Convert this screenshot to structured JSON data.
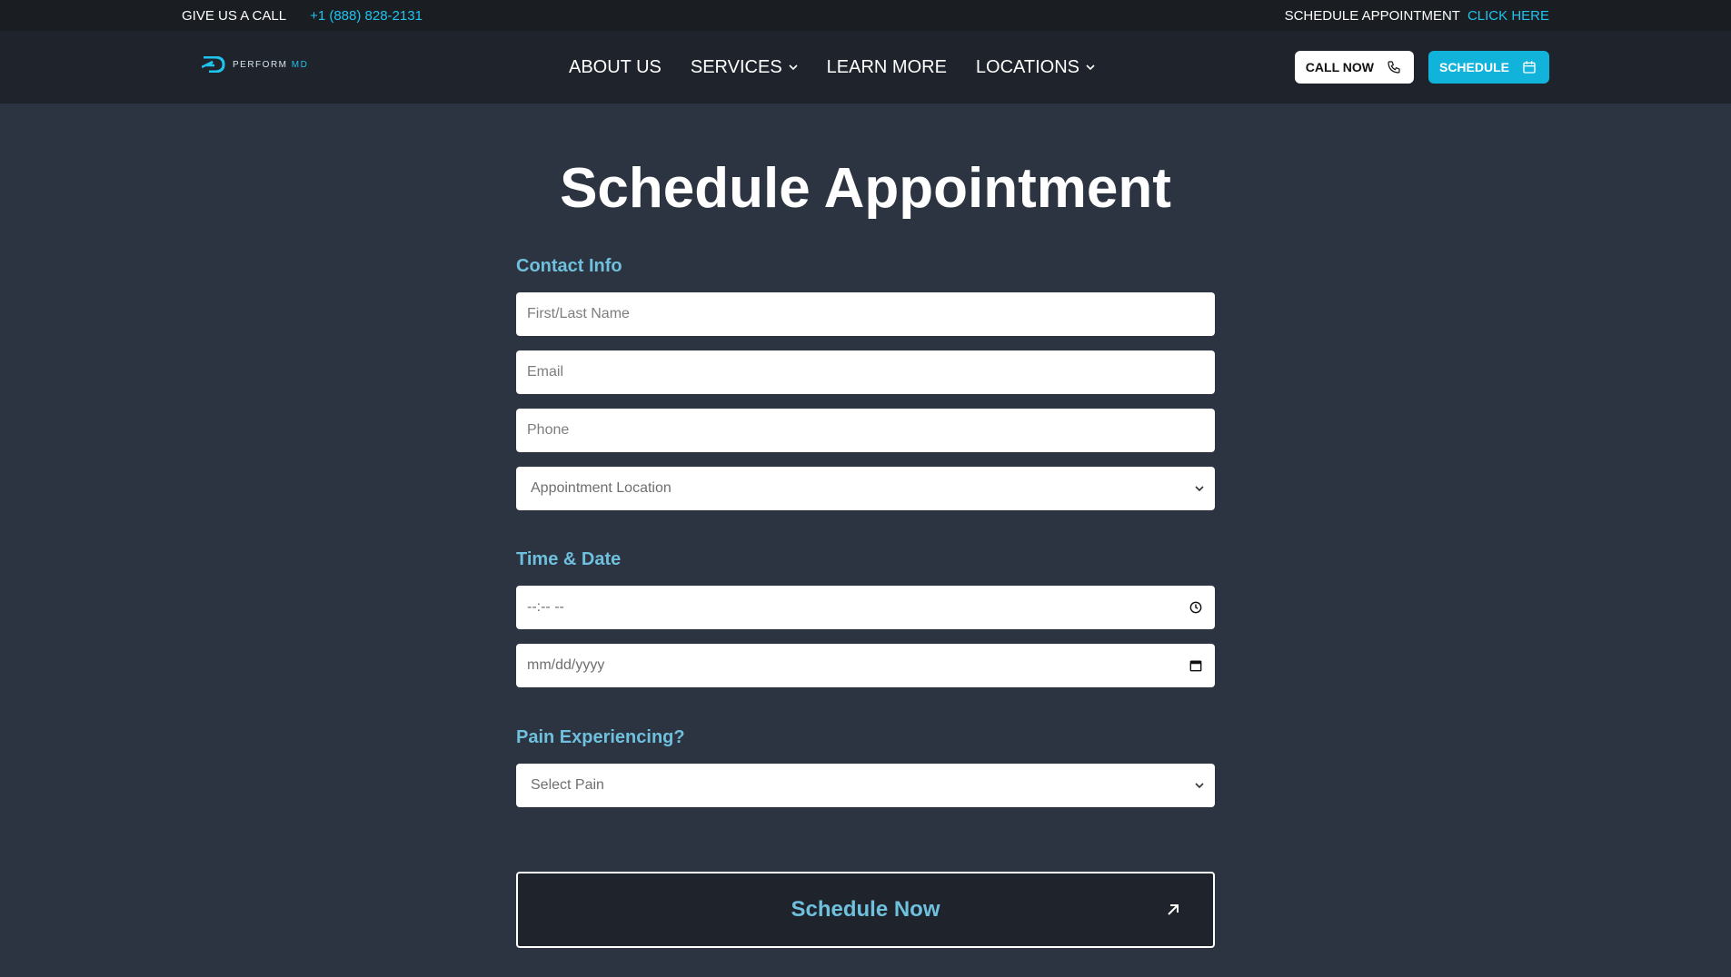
{
  "topbar": {
    "call_label": "GIVE US A CALL",
    "phone": "+1 (888) 828-2131",
    "schedule_label": "SCHEDULE APPOINTMENT",
    "schedule_link": "CLICK HERE"
  },
  "brand": {
    "logo_text_a": "PERFORM",
    "logo_text_b": "MD",
    "accent": "#1ec4ee"
  },
  "nav": {
    "items": [
      {
        "label": "ABOUT US"
      },
      {
        "label": "SERVICES"
      },
      {
        "label": "LEARN MORE"
      },
      {
        "label": "LOCATIONS"
      }
    ],
    "call_button": "CALL NOW",
    "schedule_button": "SCHEDULE"
  },
  "page": {
    "title": "Schedule Appointment"
  },
  "form": {
    "contact_heading": "Contact Info",
    "name_placeholder": "First/Last Name",
    "email_placeholder": "Email",
    "phone_placeholder": "Phone",
    "location_select": "Appointment Location",
    "time_heading": "Time & Date",
    "time_placeholder": "--:-- --",
    "date_placeholder": "mm/dd/yyyy",
    "pain_heading": "Pain Experiencing?",
    "pain_select": "Select Pain",
    "submit_label": "Schedule Now"
  },
  "colors": {
    "background": "#2c3341",
    "topbar": "#1a1d22",
    "navbar": "#1f232b",
    "label_blue": "#6fc0dd",
    "button_blue": "#12b3da"
  }
}
